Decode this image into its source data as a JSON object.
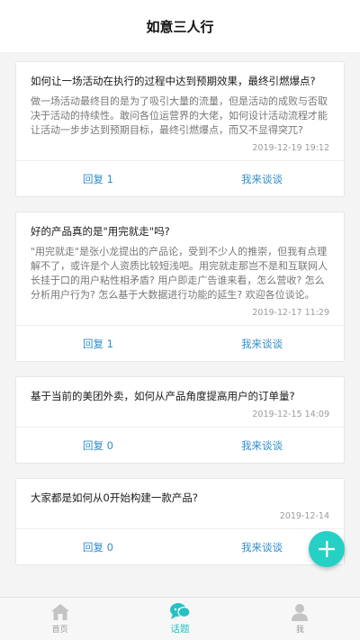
{
  "header": {
    "title": "如意三人行"
  },
  "posts": [
    {
      "title": "如何让一场活动在执行的过程中达到预期效果，最终引燃爆点?",
      "desc": "做一场活动最终目的是为了吸引大量的流量，但是活动的成败与否取决于活动的持续性。敢问各位运营界的大佬，如何设计活动流程才能让活动一步步达到预期目标，最终引燃爆点，而又不显得突兀?",
      "time": "2019-12-19 19:12",
      "reply": "回复 1",
      "talk": "我来谈谈"
    },
    {
      "title": "好的产品真的是\"用完就走\"吗?",
      "desc": "\"用完就走\"是张小龙提出的产品论，受到不少人的推崇，但我有点理解不了，或许是个人资质比较短浅吧。用完就走那岂不是和互联网人长挂于口的用户粘性相矛盾? 用户即走广告谁来看，怎么营收? 怎么分析用户行为? 怎么基于大数据进行功能的延生? 欢迎各位谈论。",
      "time": "2019-12-17 11:29",
      "reply": "回复 1",
      "talk": "我来谈谈"
    },
    {
      "title": "基于当前的美团外卖，如何从产品角度提高用户的订单量?",
      "desc": "",
      "time": "2019-12-15 14:09",
      "reply": "回复 0",
      "talk": "我来谈谈"
    },
    {
      "title": "大家都是如何从0开始构建一款产品?",
      "desc": "",
      "time": "2019-12-14",
      "reply": "回复 0",
      "talk": "我来谈谈"
    }
  ],
  "fab": {
    "icon": "plus-icon"
  },
  "tabs": [
    {
      "label": "首页",
      "icon": "home-icon"
    },
    {
      "label": "话题",
      "icon": "chat-icon"
    },
    {
      "label": "我",
      "icon": "user-icon"
    }
  ],
  "colors": {
    "accent": "#25c1c4",
    "link": "#2f8ec9",
    "fab": "#25d0c4"
  }
}
